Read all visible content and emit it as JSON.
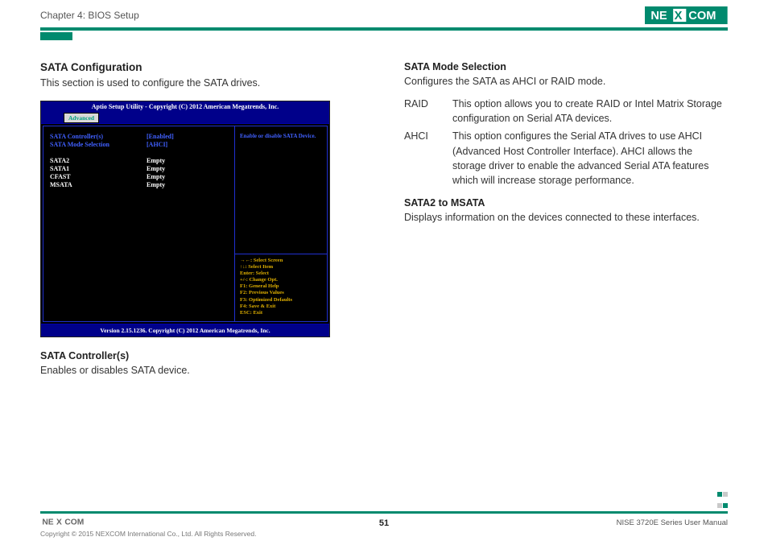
{
  "header": {
    "chapter": "Chapter 4: BIOS Setup",
    "logo_text_left": "NE",
    "logo_text_mid": "X",
    "logo_text_right": "COM"
  },
  "left": {
    "title": "SATA Configuration",
    "subtitle": "This section is used to configure the SATA drives.",
    "controller_head": "SATA Controller(s)",
    "controller_desc": "Enables or disables SATA device."
  },
  "bios": {
    "top": "Aptio Setup Utility - Copyright (C) 2012 American Megatrends, Inc.",
    "tab": "Advanced",
    "rows_highlight": [
      {
        "label": "SATA Controller(s)",
        "value": "[Enabled]"
      },
      {
        "label": "SATA Mode Selection",
        "value": "[AHCI]"
      }
    ],
    "rows_white": [
      {
        "label": "SATA2",
        "value": "Empty"
      },
      {
        "label": "SATA1",
        "value": "Empty"
      },
      {
        "label": "CFAST",
        "value": "Empty"
      },
      {
        "label": "MSATA",
        "value": "Empty"
      }
    ],
    "help_text": "Enable or disable SATA Device.",
    "hints": {
      "h1a": "→←",
      "h1b": ": Select Screen",
      "h2a": "↑↓",
      "h2b": ": Select Item",
      "h3a": "Enter",
      "h3b": ": Select",
      "h4a": "+/-",
      "h4b": ": Change Opt.",
      "h5a": "F1",
      "h5b": ": General Help",
      "h6a": "F2",
      "h6b": ": Previous Values",
      "h7a": "F3",
      "h7b": ": Optimized Defaults",
      "h8a": "F4",
      "h8b": ": Save & Exit",
      "h9a": "ESC",
      "h9b": ": Exit"
    },
    "footer": "Version 2.15.1236. Copyright (C) 2012 American Megatrends, Inc."
  },
  "right": {
    "mode_head": "SATA Mode Selection",
    "mode_desc": "Configures the SATA as AHCI or RAID mode.",
    "opts": {
      "raid_k": "RAID",
      "raid_v": "This option allows you to create RAID or Intel Matrix Storage configuration on Serial ATA devices.",
      "ahci_k": "AHCI",
      "ahci_v": "This option configures the Serial ATA drives to use AHCI (Advanced Host Controller Interface). AHCI allows the storage driver to enable the advanced Serial ATA features which will increase storage performance."
    },
    "s2m_head": "SATA2 to MSATA",
    "s2m_desc": "Displays information on the devices connected to these interfaces."
  },
  "footer": {
    "copyright": "Copyright © 2015 NEXCOM International Co., Ltd. All Rights Reserved.",
    "page": "51",
    "manual": "NISE 3720E Series User Manual"
  },
  "colors": {
    "brand_green": "#008a6e",
    "brand_blue": "#00008a"
  }
}
